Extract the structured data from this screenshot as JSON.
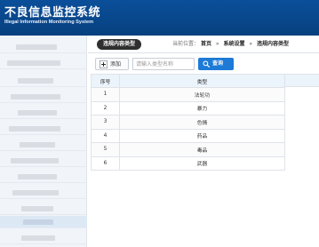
{
  "header": {
    "title": "不良信息监控系统",
    "subtitle": "Illegal Information Monitoring System"
  },
  "breadcrumb": {
    "tab": "违规内容类型",
    "now_label": "当前位置：",
    "items": [
      "首页",
      "系统设置",
      "违规内容类型"
    ],
    "separator": "»"
  },
  "toolbar": {
    "add_label": "添加",
    "search_placeholder": "请输入类型名称",
    "search_label": "查询"
  },
  "table": {
    "headers": [
      "序号",
      "类型"
    ],
    "rows": [
      {
        "no": "1",
        "type": "法轮功"
      },
      {
        "no": "2",
        "type": "暴力"
      },
      {
        "no": "3",
        "type": "色情"
      },
      {
        "no": "4",
        "type": "药品"
      },
      {
        "no": "5",
        "type": "毒品"
      },
      {
        "no": "6",
        "type": "武器"
      }
    ]
  },
  "colors": {
    "header_bg": "#0a4f9a",
    "accent": "#1d7ad6",
    "tab_bg": "#2f2f2f",
    "table_header_bg": "#ebf3fb"
  },
  "icons": {
    "add": "add-icon",
    "search": "search-icon"
  }
}
